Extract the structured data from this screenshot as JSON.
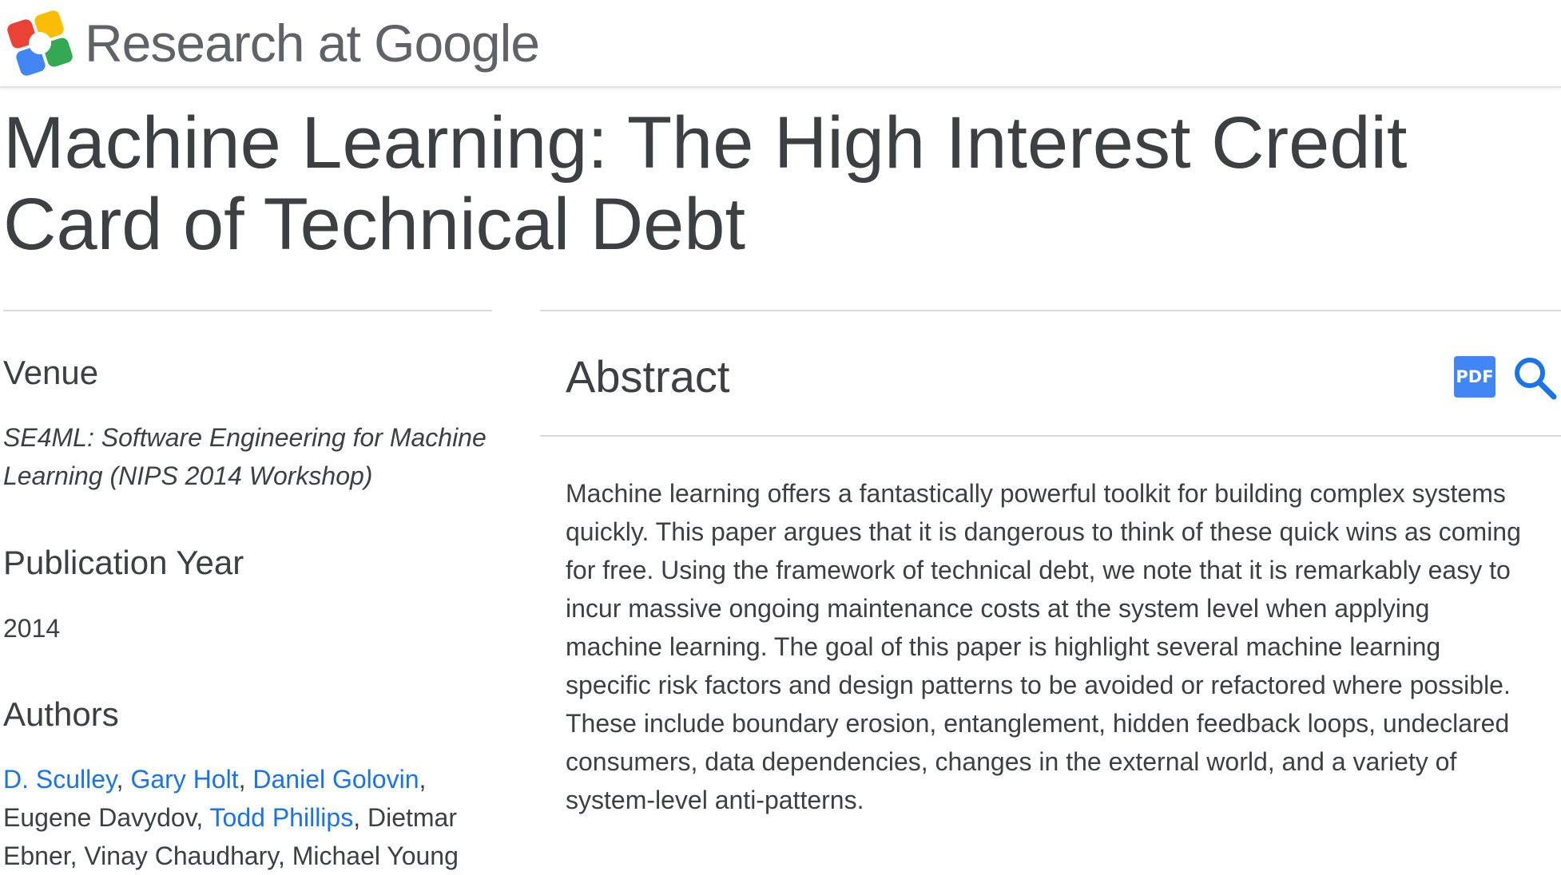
{
  "header": {
    "brand": "Research at Google"
  },
  "title": "Machine Learning: The High Interest Credit Card of Technical Debt",
  "sidebar": {
    "venue_heading": "Venue",
    "venue": "SE4ML: Software Engineering for Machine Learning (NIPS 2014 Workshop)",
    "year_heading": "Publication Year",
    "year": "2014",
    "authors_heading": "Authors",
    "authors": [
      {
        "name": "D. Sculley",
        "link": true,
        "sep": ", "
      },
      {
        "name": "Gary Holt",
        "link": true,
        "sep": ", "
      },
      {
        "name": "Daniel Golovin",
        "link": true,
        "sep": ", "
      },
      {
        "name": "Eugene Davydov",
        "link": false,
        "sep": ", "
      },
      {
        "name": "Todd Phillips",
        "link": true,
        "sep": ", "
      },
      {
        "name": "Dietmar Ebner",
        "link": false,
        "sep": ", "
      },
      {
        "name": "Vinay Chaudhary",
        "link": false,
        "sep": ", "
      },
      {
        "name": "Michael Young",
        "link": false,
        "sep": ""
      }
    ]
  },
  "abstract": {
    "heading": "Abstract",
    "pdf_label": "PDF",
    "text": "Machine learning offers a fantastically powerful toolkit for building complex systems quickly. This paper argues that it is dangerous to think of these quick wins as coming for free. Using the framework of technical debt, we note that it is remarkably easy to incur massive ongoing maintenance costs at the system level when applying machine learning. The goal of this paper is highlight several machine learning specific risk factors and design patterns to be avoided or refactored where possible. These include boundary erosion, entanglement, hidden feedback loops, undeclared consumers, data dependencies, changes in the external world, and a variety of system-level anti-patterns."
  },
  "colors": {
    "link": "#1a73e8",
    "pdf": "#4285f4",
    "text": "#3c4043"
  },
  "icons": {
    "logo": "google-research-logo-icon",
    "pdf": "pdf-icon",
    "search": "search-icon"
  }
}
